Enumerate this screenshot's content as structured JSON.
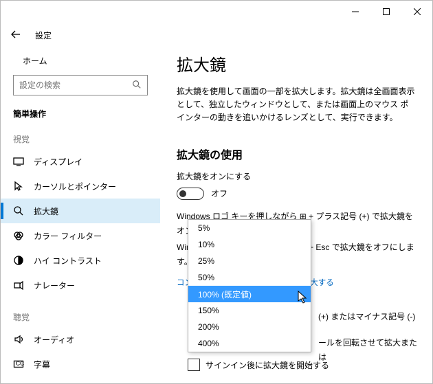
{
  "window": {
    "title": "設定"
  },
  "sidebar": {
    "home": "ホーム",
    "search_placeholder": "設定の検索",
    "group": "簡単操作",
    "section_vision": "視覚",
    "section_hearing": "聴覚",
    "items_vision": [
      {
        "label": "ディスプレイ",
        "icon": "display"
      },
      {
        "label": "カーソルとポインター",
        "icon": "cursor"
      },
      {
        "label": "拡大鏡",
        "icon": "magnifier",
        "selected": true
      },
      {
        "label": "カラー フィルター",
        "icon": "color-filter"
      },
      {
        "label": "ハイ コントラスト",
        "icon": "contrast"
      },
      {
        "label": "ナレーター",
        "icon": "narrator"
      }
    ],
    "items_hearing": [
      {
        "label": "オーディオ",
        "icon": "audio"
      },
      {
        "label": "字幕",
        "icon": "captions"
      }
    ]
  },
  "main": {
    "heading": "拡大鏡",
    "description": "拡大鏡を使用して画面の一部を拡大します。拡大鏡は全画面表示として、独立したウィンドウとして、または画面上のマウス ポインターの動きを追いかけるレンズとして、実行できます。",
    "using_heading": "拡大鏡の使用",
    "turn_on_label": "拡大鏡をオンにする",
    "toggle_state": "オフ",
    "hint_on_prefix": "Windows ロゴ キーを押しながら ",
    "hint_on_suffix": " + プラス記号 (+) で拡大鏡をオンにします。",
    "hint_off_prefix": "Windows ロゴ キーを押しながら ",
    "hint_off_suffix": " + Esc で拡大鏡をオフにします。",
    "link_text": "コンピューター上のすべての表示を拡大する",
    "peek1": "(+) またはマイナス記号 (-)",
    "peek2": "ールを回転させて拡大または",
    "checkbox_label": "サインイン後に拡大鏡を開始する"
  },
  "dropdown": {
    "options": [
      "5%",
      "10%",
      "25%",
      "50%",
      "100% (既定値)",
      "150%",
      "200%",
      "400%"
    ],
    "selected_index": 4
  }
}
